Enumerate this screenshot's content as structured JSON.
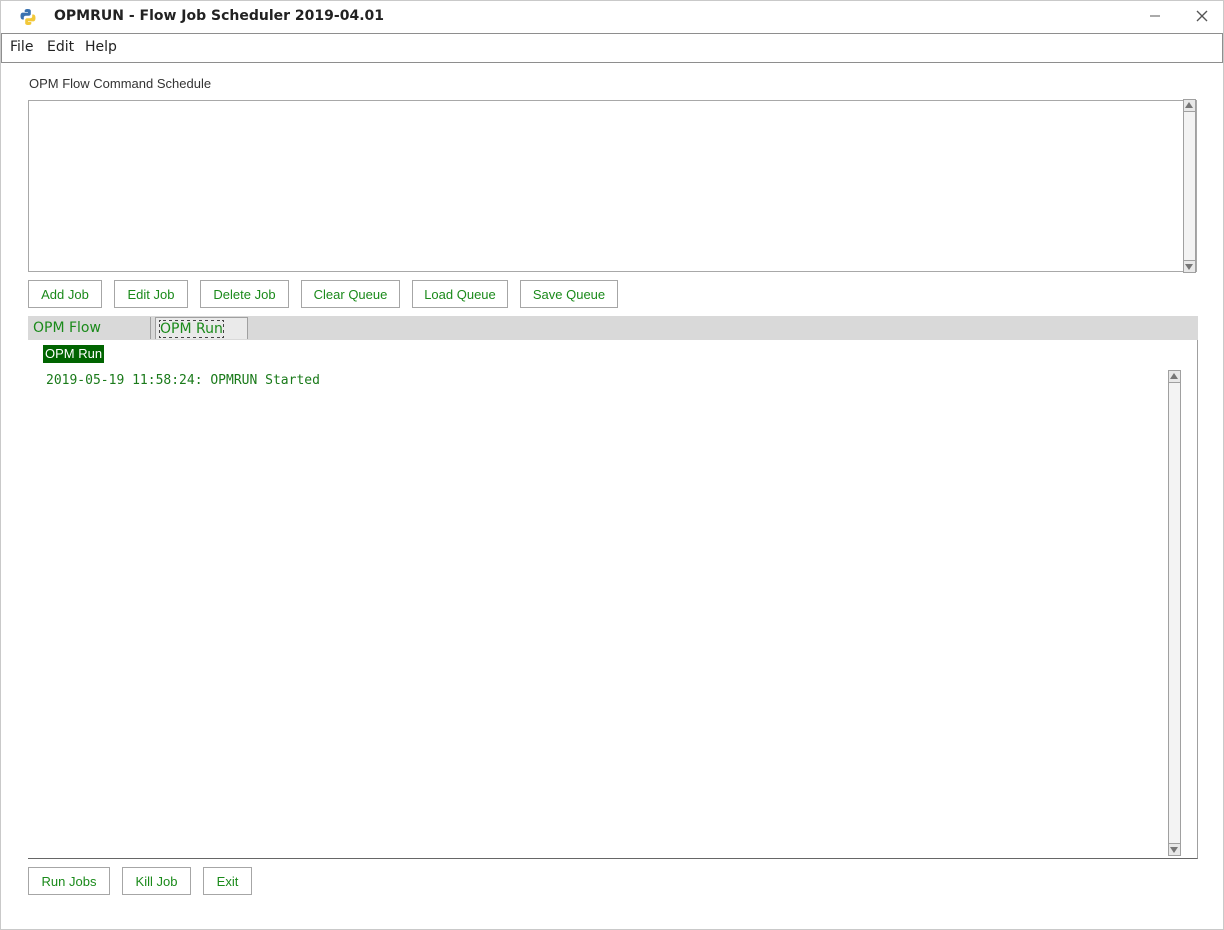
{
  "window": {
    "title": "OPMRUN - Flow Job Scheduler 2019-04.01"
  },
  "menu": {
    "file": "File",
    "edit": "Edit",
    "help": "Help"
  },
  "schedule": {
    "label": "OPM Flow Command Schedule"
  },
  "queue_buttons": {
    "add_job": "Add Job",
    "edit_job": "Edit Job",
    "delete_job": "Delete Job",
    "clear_queue": "Clear Queue",
    "load_queue": "Load Queue",
    "save_queue": "Save Queue"
  },
  "tabs": [
    {
      "label": "OPM Flow Output",
      "selected": false
    },
    {
      "label": "OPM Run Log",
      "selected": true
    }
  ],
  "log_panel": {
    "label": "OPM Run",
    "lines": "2019-05-19 11:58:24: OPMRUN Started"
  },
  "bottom_buttons": {
    "run_jobs": "Run Jobs",
    "kill_job": "Kill Job",
    "exit": "Exit"
  },
  "colors": {
    "button_text": "#1a8a1a",
    "panel_label_bg": "#006400",
    "tab_strip": "#d9d9d9"
  }
}
